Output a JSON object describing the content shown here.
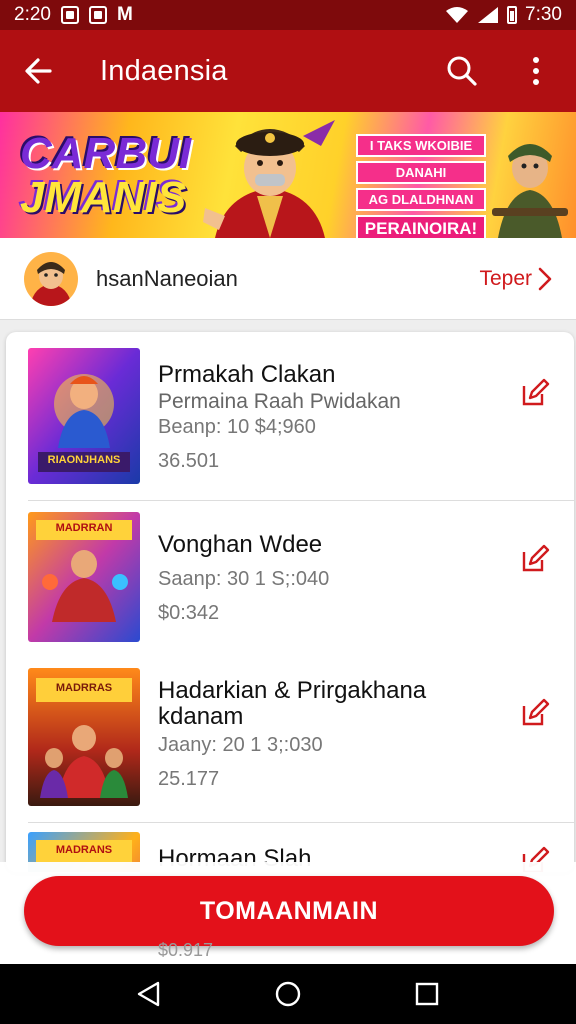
{
  "status_bar": {
    "time_left": "2:20",
    "carrier_glyph": "M",
    "time_right": "7:30"
  },
  "app_bar": {
    "title": "Indaensia",
    "back_icon": "back-arrow-icon",
    "search_icon": "search-icon",
    "more_icon": "more-vert-icon"
  },
  "banner": {
    "logo_line1": "CARBUI",
    "logo_line2": "JMANIS",
    "pill_1": "I TAKS WKOIBIE",
    "pill_2": "DANAHI",
    "pill_3": "AG DLALDHNAN",
    "pill_4": "PERAINOIRA!"
  },
  "channel": {
    "name": "hsanNaneoian",
    "link_label": "Teper"
  },
  "items": [
    {
      "title": "Prmakah Clakan",
      "subtitle": "Permaina Raah Pwidakan",
      "meta1": "Beanp: 10 $4;960",
      "meta2": "36.501",
      "thumb_label": "RIAONJHANS"
    },
    {
      "title": "Vonghan Wdee",
      "subtitle": "",
      "meta1": "Saanp: 30 1 S;:040",
      "meta2": "$0:342",
      "thumb_label": "MADRRAN"
    },
    {
      "title": "Hadarkian & Prirgakhana kdanam",
      "subtitle": "",
      "meta1": "Jaany: 20 1 3;:030",
      "meta2": "25.177",
      "thumb_label": "MADRRAS"
    },
    {
      "title": "Hormaan Slah",
      "subtitle": "",
      "meta1": "",
      "meta2": "$0.917",
      "thumb_label": "MADRANS"
    }
  ],
  "cta": {
    "label": "TOMAANMAIN"
  },
  "nav": {
    "back": "nav-back-icon",
    "home": "nav-home-icon",
    "recents": "nav-recents-icon"
  },
  "colors": {
    "app_bar": "#b00f12",
    "status_bar": "#7e0a0c",
    "accent": "#e3111a",
    "link": "#d01a1d"
  }
}
